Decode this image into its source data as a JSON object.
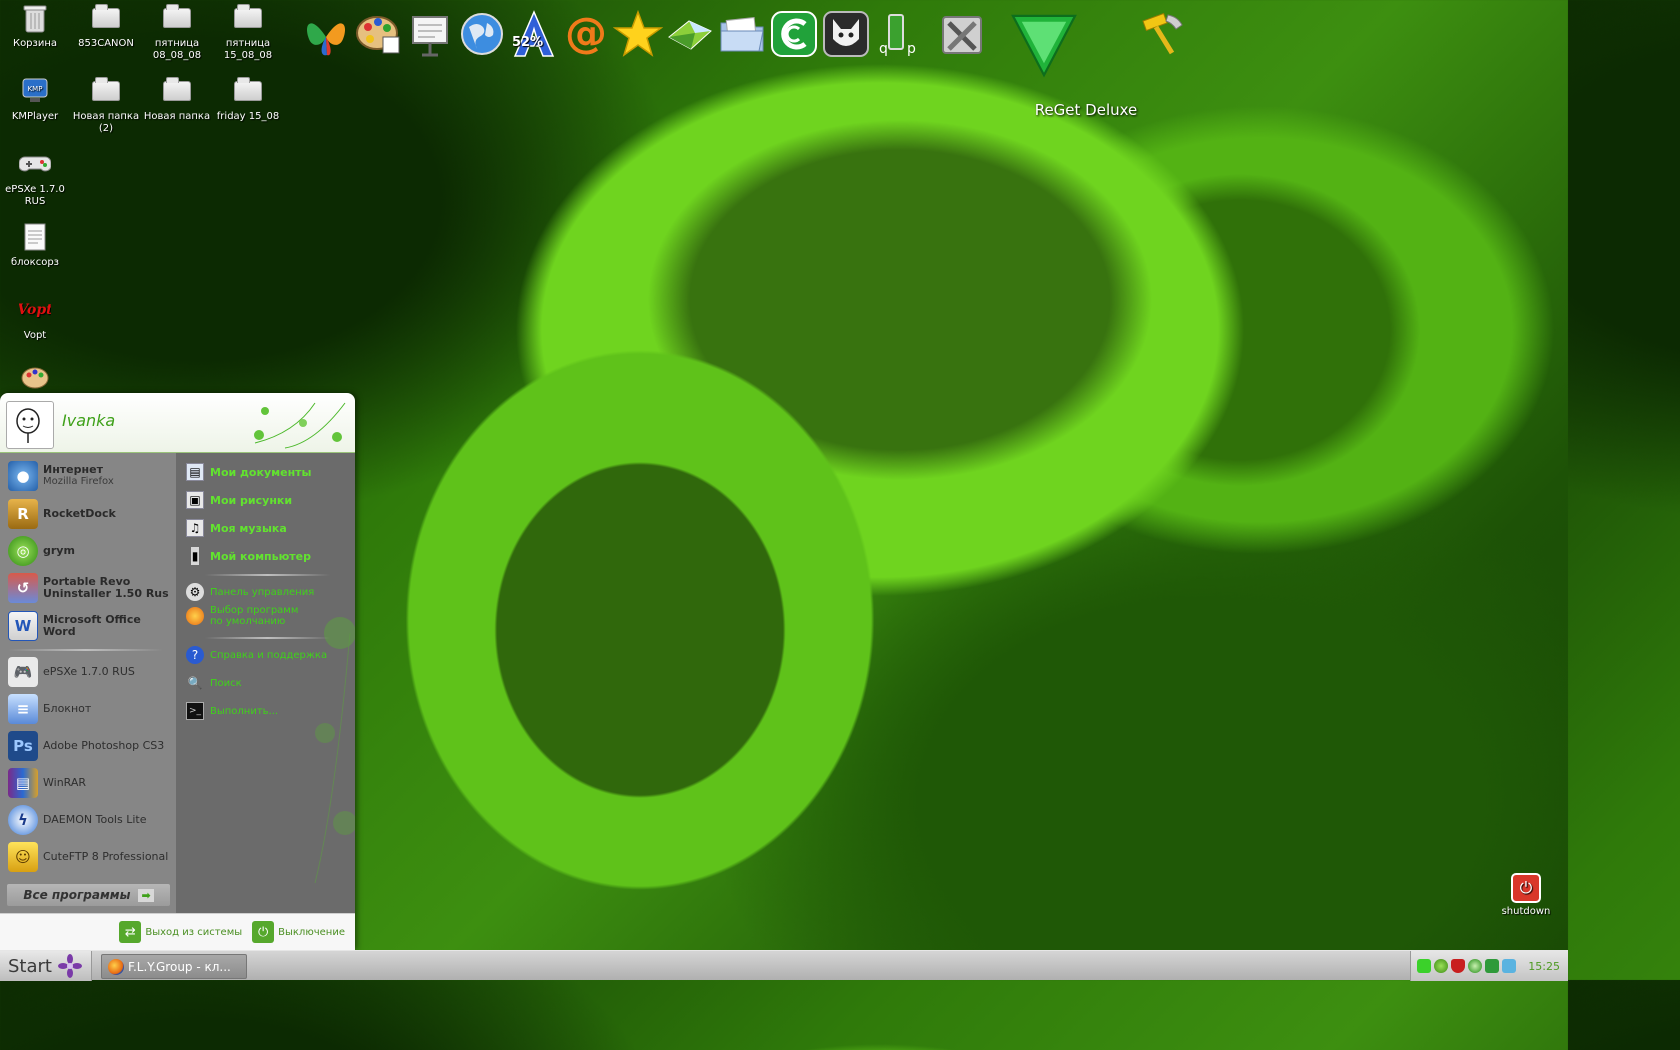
{
  "desktop": {
    "icons": [
      {
        "label": "Корзина",
        "icon": "recycle-bin-icon"
      },
      {
        "label": "853CANON",
        "icon": "folder-icon"
      },
      {
        "label": "пятница 08_08_08",
        "icon": "folder-icon"
      },
      {
        "label": "пятница 15_08_08",
        "icon": "folder-icon"
      },
      {
        "label": "KMPlayer",
        "icon": "kmplayer-icon"
      },
      {
        "label": "Новая папка (2)",
        "icon": "folder-icon"
      },
      {
        "label": "Новая папка",
        "icon": "folder-icon"
      },
      {
        "label": "friday 15_08",
        "icon": "folder-icon"
      },
      {
        "label": "ePSXe 1.7.0 RUS",
        "icon": "gamepad-icon"
      },
      {
        "label": "блоксорз",
        "icon": "notepad-icon"
      },
      {
        "label": "Vopt",
        "icon": "vopt-icon"
      }
    ],
    "shutdown_label": "shutdown"
  },
  "dock": {
    "items": [
      "msn-butterfly-icon",
      "paint-palette-icon",
      "presentation-icon",
      "globe-icon",
      "a-52-percent-icon",
      "at-sign-icon",
      "star-icon",
      "gem-icon",
      "folder-docs-icon",
      "torrent-icon",
      "foobar-icon",
      "qip-icon",
      "tools-cross-icon",
      "reget-arrow-icon",
      "hammer-icon"
    ],
    "percent_badge": "52%",
    "hover_caption": "ReGet Deluxe"
  },
  "start_menu": {
    "user_name": "Ivanka",
    "pinned": [
      {
        "name": "Интернет",
        "sub": "Mozilla Firefox",
        "icon": "firefox-icon"
      },
      {
        "name": "RocketDock",
        "sub": "",
        "icon": "rocketdock-icon"
      },
      {
        "name": "grym",
        "sub": "",
        "icon": "grym-icon"
      },
      {
        "name": "Portable Revo Uninstaller 1.50 Rus",
        "sub": "",
        "icon": "revo-icon"
      },
      {
        "name": "Microsoft Office Word",
        "sub": "",
        "icon": "word-icon"
      }
    ],
    "recent": [
      {
        "name": "ePSXe 1.7.0 RUS",
        "icon": "gamepad-icon"
      },
      {
        "name": "Блокнот",
        "icon": "notepad-icon"
      },
      {
        "name": "Adobe Photoshop CS3",
        "icon": "photoshop-icon"
      },
      {
        "name": "WinRAR",
        "icon": "winrar-icon"
      },
      {
        "name": "DAEMON Tools Lite",
        "icon": "daemon-icon"
      },
      {
        "name": "CuteFTP 8 Professional",
        "icon": "cuteftp-icon"
      }
    ],
    "all_programs": "Все программы",
    "right_bold": [
      {
        "label": "Мои документы",
        "icon": "my-documents-icon"
      },
      {
        "label": "Мои рисунки",
        "icon": "my-pictures-icon"
      },
      {
        "label": "Моя музыка",
        "icon": "my-music-icon"
      },
      {
        "label": "Мой компьютер",
        "icon": "my-computer-icon"
      }
    ],
    "right_normal": [
      {
        "label": "Панель управления",
        "icon": "control-panel-icon"
      },
      {
        "label": "Выбор программ по умолчанию",
        "icon": "default-programs-icon"
      },
      {
        "label": "Справка и поддержка",
        "icon": "help-icon"
      },
      {
        "label": "Поиск",
        "icon": "search-icon"
      },
      {
        "label": "Выполнить...",
        "icon": "run-icon"
      }
    ],
    "logoff": "Выход из системы",
    "shutdown": "Выключение"
  },
  "taskbar": {
    "start_label": "Start",
    "task_button": "F.L.Y.Group - кл...",
    "clock": "15:25"
  },
  "colors": {
    "accent_green": "#3fa11a",
    "menu_gray": "#7f7f7f"
  }
}
